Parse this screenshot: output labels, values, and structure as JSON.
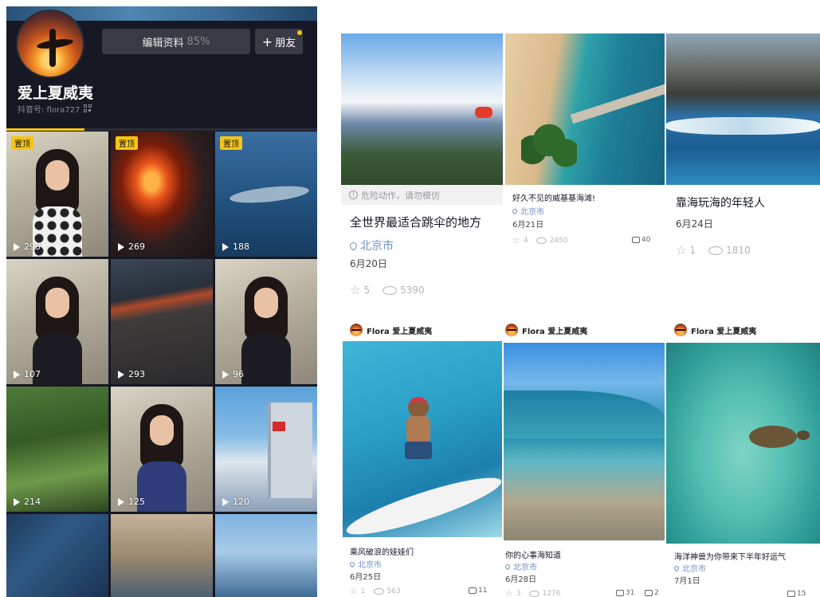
{
  "profile": {
    "edit_label": "编辑资料",
    "edit_percent": "85%",
    "friend_label": "朋友",
    "nickname": "爱上夏威夷",
    "douyin_id": "抖音号: flora727"
  },
  "grid": [
    {
      "pinned": true,
      "pin_label": "置顶",
      "plays": "293",
      "scene": "woman-polka-dot"
    },
    {
      "pinned": true,
      "pin_label": "置顶",
      "plays": "269",
      "scene": "lava"
    },
    {
      "pinned": true,
      "pin_label": "置顶",
      "plays": "188",
      "scene": "whale"
    },
    {
      "pinned": false,
      "plays": "107",
      "scene": "woman-closeup"
    },
    {
      "pinned": false,
      "plays": "293",
      "scene": "lava-rock"
    },
    {
      "pinned": false,
      "plays": "96",
      "scene": "woman-office"
    },
    {
      "pinned": false,
      "plays": "214",
      "scene": "forest"
    },
    {
      "pinned": false,
      "plays": "125",
      "scene": "woman-blue"
    },
    {
      "pinned": false,
      "plays": "120",
      "scene": "building"
    },
    {
      "pinned": false,
      "plays": "",
      "scene": "denim"
    },
    {
      "pinned": false,
      "plays": "",
      "scene": "classroom"
    },
    {
      "pinned": false,
      "plays": "",
      "scene": "harbor"
    }
  ],
  "cards": [
    {
      "warning": "危险动作，请勿模仿",
      "title": "全世界最适合跳伞的地方",
      "location": "北京市",
      "date": "6月20日",
      "stars": "5",
      "views": "5390"
    },
    {
      "title": "好久不见的威基基海滩!",
      "location": "北京市",
      "date": "6月21日",
      "stars": "4",
      "views": "2450",
      "comments": "40"
    },
    {
      "title": "靠海玩海的年轻人",
      "date": "6月24日",
      "stars": "1",
      "views": "1810"
    },
    {
      "author": "Flora 爱上夏威夷",
      "title": "乘风破浪的娃娃们",
      "location": "北京市",
      "date": "6月25日",
      "stars": "1",
      "views": "563",
      "comments": "11"
    },
    {
      "author": "Flora 爱上夏威夷",
      "title": "你的心事海知道",
      "location": "北京市",
      "date": "6月28日",
      "stars": "3",
      "views": "1276",
      "comments": "31",
      "shares": "2"
    },
    {
      "author": "Flora 爱上夏威夷",
      "title": "海洋神兽为你带来下半年好运气",
      "location": "北京市",
      "date": "7月1日",
      "comments": "15"
    }
  ]
}
